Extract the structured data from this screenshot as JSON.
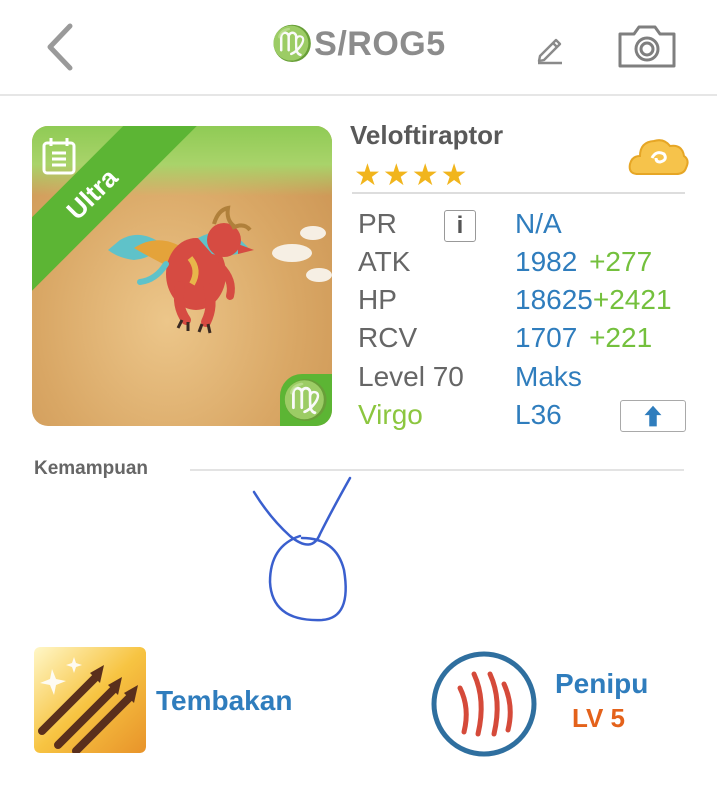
{
  "header": {
    "title": "♍S/ROG5"
  },
  "icons": {
    "back": "chevron-left-icon",
    "edit": "pencil-icon",
    "camera": "camera-icon",
    "cloud": "cloud-icon",
    "info": "info-icon",
    "upgrade": "arrow-up-icon",
    "card_corner": "document-icon",
    "attribute": "virgo-icon",
    "skill": "arrows-icon",
    "awaken": "claw-icon"
  },
  "card": {
    "ribbon": "Ultra",
    "attribute_symbol": "♍"
  },
  "monster": {
    "name": "Veloftiraptor",
    "stars_display": "★★★★",
    "star_count": 4
  },
  "stats": {
    "pr": {
      "label": "PR",
      "info_glyph": "i",
      "value": "N/A"
    },
    "atk": {
      "label": "ATK",
      "value": "1982",
      "bonus": "+277"
    },
    "hp": {
      "label": "HP",
      "value": "18625",
      "bonus": "+2421"
    },
    "rcv": {
      "label": "RCV",
      "value": "1707",
      "bonus": "+221"
    },
    "level": {
      "label": "Level 70",
      "value": "Maks"
    },
    "sign": {
      "label": "Virgo",
      "value": "L36"
    }
  },
  "section": {
    "title": "Kemampuan"
  },
  "skill": {
    "name": "Tembakan"
  },
  "awaken": {
    "name": "Penipu",
    "level": "LV 5"
  },
  "colors": {
    "accent_blue": "#2f7dbd",
    "bonus_green": "#74c03d",
    "ultra_green": "#5cb534",
    "star_gold": "#f1b51d",
    "level_orange": "#e4621b"
  }
}
